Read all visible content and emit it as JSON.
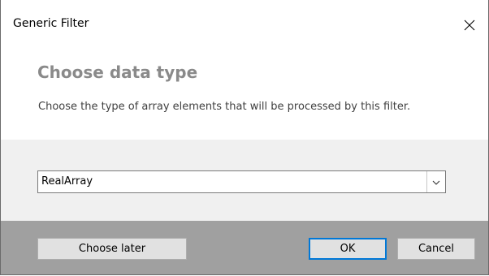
{
  "window": {
    "title": "Generic Filter"
  },
  "header": {
    "heading": "Choose data type",
    "description": "Choose the type of array elements that will be processed by this filter."
  },
  "content": {
    "data_type_select": {
      "selected": "RealArray"
    }
  },
  "footer": {
    "choose_later_label": "Choose later",
    "ok_label": "OK",
    "cancel_label": "Cancel"
  },
  "icons": {
    "close": "close-icon",
    "dropdown": "chevron-down-icon"
  },
  "colors": {
    "heading": "#8a8a8a",
    "content_bg": "#f0f0f0",
    "footer_bg": "#a0a0a0",
    "default_button_border": "#0078d7"
  }
}
